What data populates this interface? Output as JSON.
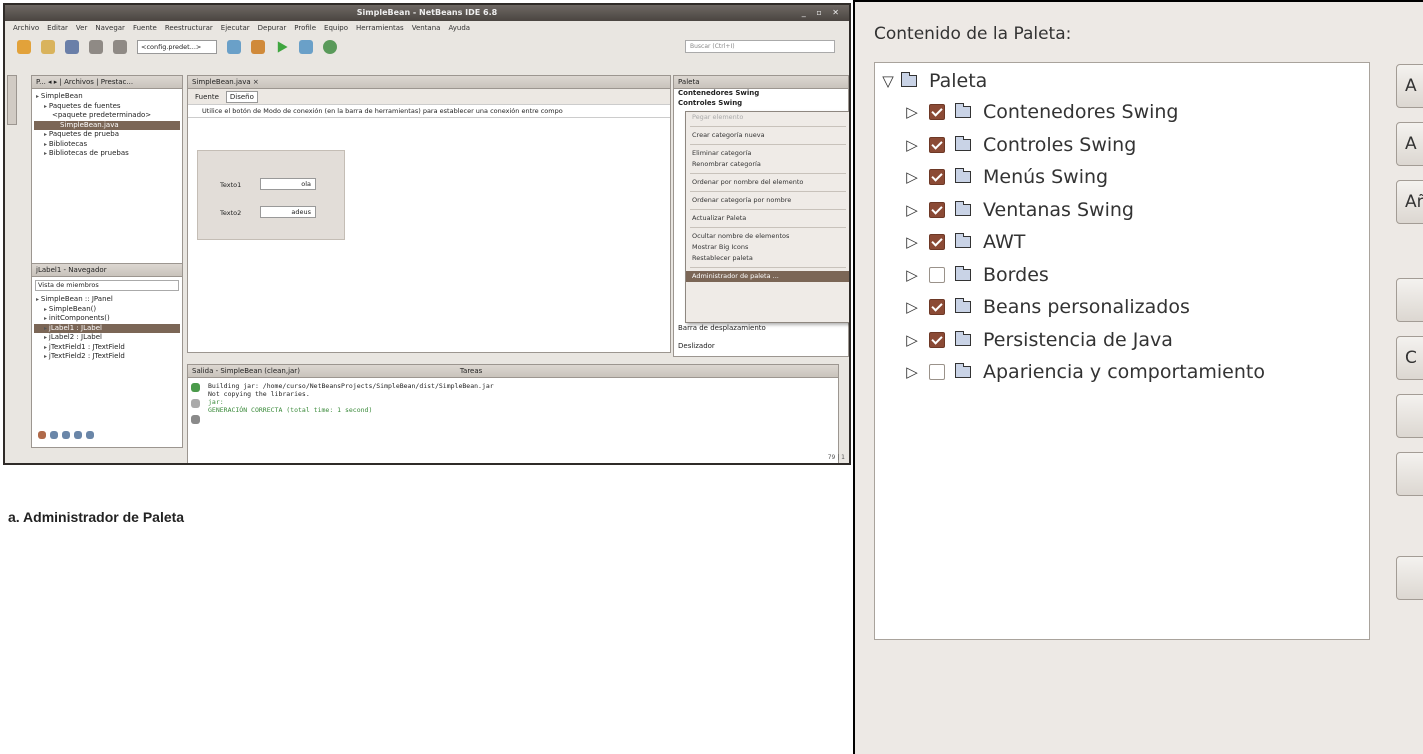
{
  "window": {
    "title": "SimpleBean - NetBeans IDE 6.8",
    "controls": "_ ▫ ✕"
  },
  "menu": [
    "Archivo",
    "Editar",
    "Ver",
    "Navegar",
    "Fuente",
    "Reestructurar",
    "Ejecutar",
    "Depurar",
    "Profile",
    "Equipo",
    "Herramientas",
    "Ventana",
    "Ayuda"
  ],
  "toolbar": {
    "config_select": "<config.predet...>",
    "search_placeholder": "Buscar (Ctrl+I)"
  },
  "projects": {
    "tabs": "P... ◂ ▸ | Archivos | Prestac...",
    "tree": [
      {
        "label": "SimpleBean",
        "indent": 0,
        "selected": false
      },
      {
        "label": "Paquetes de fuentes",
        "indent": 1,
        "selected": false
      },
      {
        "label": "<paquete predeterminado>",
        "indent": 2,
        "selected": false
      },
      {
        "label": "SimpleBean.java",
        "indent": 3,
        "selected": true
      },
      {
        "label": "Paquetes de prueba",
        "indent": 1,
        "selected": false
      },
      {
        "label": "Bibliotecas",
        "indent": 1,
        "selected": false
      },
      {
        "label": "Bibliotecas de pruebas",
        "indent": 1,
        "selected": false
      }
    ]
  },
  "navigator": {
    "title": "jLabel1 - Navegador",
    "select": "Vista de miembros",
    "tree": [
      {
        "label": "SimpleBean :: JPanel",
        "indent": 0,
        "selected": false
      },
      {
        "label": "SimpleBean()",
        "indent": 1,
        "selected": false
      },
      {
        "label": "initComponents()",
        "indent": 1,
        "selected": false
      },
      {
        "label": "jLabel1 : JLabel",
        "indent": 1,
        "selected": true
      },
      {
        "label": "jLabel2 : JLabel",
        "indent": 1,
        "selected": false
      },
      {
        "label": "jTextField1 : JTextField",
        "indent": 1,
        "selected": false
      },
      {
        "label": "jTextField2 : JTextField",
        "indent": 1,
        "selected": false
      }
    ]
  },
  "editor": {
    "tab": "SimpleBean.java ×",
    "source_tab": "Fuente",
    "design_tab": "Diseño",
    "hint": "Utilice el botón de Modo de conexión (en la barra de herramientas) para establecer una conexión entre compo",
    "label1": "Texto1",
    "value1": "ola",
    "label2": "Texto2",
    "value2": "adeus"
  },
  "palette": {
    "title": "Paleta",
    "categories": [
      "Contenedores Swing",
      "Controles Swing"
    ],
    "bottom_items": [
      "Barra de desplazamiento",
      "Deslizador"
    ]
  },
  "context_menu": {
    "items": [
      {
        "label": "Pegar elemento",
        "state": "disabled",
        "sep_after": true
      },
      {
        "label": "Crear categoría nueva",
        "state": "normal",
        "sep_after": true
      },
      {
        "label": "Eliminar categoría",
        "state": "normal",
        "sep_after": false
      },
      {
        "label": "Renombrar categoría",
        "state": "normal",
        "sep_after": true
      },
      {
        "label": "Ordenar por nombre del elemento",
        "state": "normal",
        "sep_after": true
      },
      {
        "label": "Ordenar categoría por nombre",
        "state": "normal",
        "sep_after": true
      },
      {
        "label": "Actualizar Paleta",
        "state": "normal",
        "sep_after": true
      },
      {
        "label": "Ocultar nombre de elementos",
        "state": "normal",
        "sep_after": false
      },
      {
        "label": "Mostrar Big Icons",
        "state": "normal",
        "sep_after": false
      },
      {
        "label": "Restablecer paleta",
        "state": "normal",
        "sep_after": true
      },
      {
        "label": "Administrador de paleta ...",
        "state": "active",
        "sep_after": false
      }
    ]
  },
  "output": {
    "title": "Salida - SimpleBean (clean,jar)",
    "tasks_tab": "Tareas",
    "lines": [
      "Building jar: /home/curso/NetBeansProjects/SimpleBean/dist/SimpleBean.jar",
      "Not copying the libraries.",
      "jar:",
      "GENERACIÓN CORRECTA (total time: 1 second)"
    ]
  },
  "status": "79 | 1",
  "caption": "a. Administrador de Paleta",
  "dialog": {
    "title": "Contenido de la Paleta:",
    "root": "Paleta",
    "categories": [
      {
        "label": "Contenedores Swing",
        "checked": true
      },
      {
        "label": "Controles Swing",
        "checked": true
      },
      {
        "label": "Menús Swing",
        "checked": true
      },
      {
        "label": "Ventanas Swing",
        "checked": true
      },
      {
        "label": "AWT",
        "checked": true
      },
      {
        "label": "Bordes",
        "checked": false
      },
      {
        "label": "Beans personalizados",
        "checked": true
      },
      {
        "label": "Persistencia de Java",
        "checked": true
      },
      {
        "label": "Apariencia y comportamiento",
        "checked": false
      }
    ],
    "buttons": [
      "A",
      "A",
      "Añ",
      "",
      "C",
      "",
      "",
      ""
    ]
  },
  "colors": {
    "selection": "#7b6656",
    "check_on": "#8b4a35",
    "accent_output": "#3a8a3a"
  }
}
